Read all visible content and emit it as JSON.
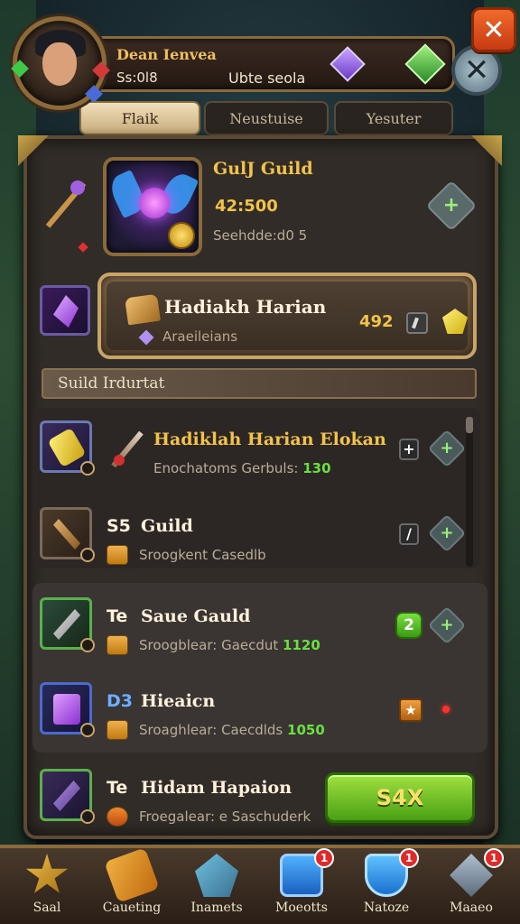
{
  "header": {
    "player_name": "Dean Ienvea",
    "player_id": "Ss:0l8",
    "status": "Ubte seola",
    "close_label": "✕",
    "round_close_label": "✕"
  },
  "tabs": [
    {
      "label": "Flaik"
    },
    {
      "label": "Neustuise"
    },
    {
      "label": "Yesuter"
    }
  ],
  "guild": {
    "title": "GulJ Guild",
    "score": "42:500",
    "subtitle": "Seehdde:d0 5",
    "plus_label": "+"
  },
  "daily": {
    "title": "Hadiakh Harian",
    "subtitle": "Araeileians",
    "value": "492"
  },
  "section": {
    "title": "Suild Irdurtat"
  },
  "rows": [
    {
      "prefix": "",
      "title": "Hadiklah Harian Elokan",
      "sub_text": "Enochatoms Gerbuls: ",
      "sub_num": "130",
      "button": "+",
      "plus": "+"
    },
    {
      "prefix": "S5",
      "title": "Guild",
      "sub_text": "Sroogkent Casedlb",
      "sub_num": "",
      "button": "/",
      "plus": "+"
    },
    {
      "prefix": "Te",
      "title": "Saue Gauld",
      "sub_text": "Sroogblear: Gaecdut ",
      "sub_num": "1120",
      "button": "2",
      "plus": "+"
    },
    {
      "prefix": "D3",
      "title": "Hieaicn",
      "sub_text": "Sroaghlear: Caecdlds ",
      "sub_num": "1050",
      "button": "★",
      "plus": ""
    },
    {
      "prefix": "Te",
      "title": "Hidam Hapaion",
      "sub_text": "Froegalear: e Saschuderk",
      "sub_num": "",
      "button": "",
      "plus": ""
    }
  ],
  "claim": {
    "label": "S4X"
  },
  "nav": [
    {
      "label": "Saal",
      "icon": "star-icon",
      "badge": ""
    },
    {
      "label": "Caueting",
      "icon": "hammer-icon",
      "badge": ""
    },
    {
      "label": "Inamets",
      "icon": "gem-icon",
      "badge": ""
    },
    {
      "label": "Moeotts",
      "icon": "shield-icon",
      "badge": "1"
    },
    {
      "label": "Natoze",
      "icon": "shield-icon",
      "badge": "1"
    },
    {
      "label": "Maaeo",
      "icon": "crossed-swords-icon",
      "badge": "1"
    }
  ],
  "colors": {
    "accent_gold": "#f2c24a",
    "positive_green": "#6ae040",
    "close_orange": "#f06a2a"
  }
}
